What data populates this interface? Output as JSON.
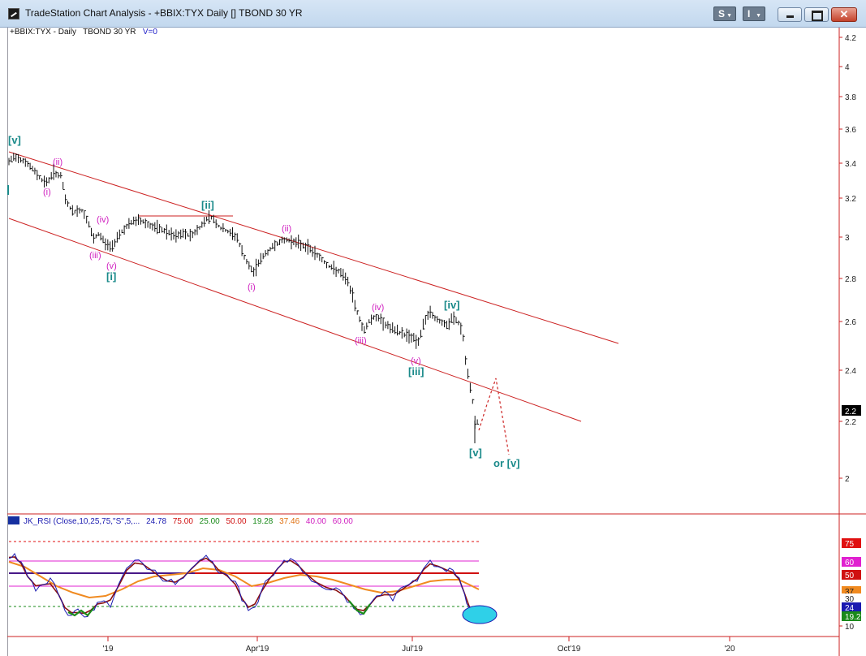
{
  "window": {
    "title": "TradeStation Chart Analysis - +BBIX:TYX Daily [] TBOND 30 YR",
    "menu_s": "S",
    "menu_i": "I",
    "close_glyph": "✕"
  },
  "series_header": {
    "symbol": "+BBIX:TYX - Daily",
    "name": "TBOND 30 YR",
    "volume": "V=0"
  },
  "price_axis": {
    "ticks": [
      "4.2",
      "4",
      "3.8",
      "3.6",
      "3.4",
      "3.2",
      "3",
      "2.8",
      "2.6",
      "2.4",
      "2.2",
      "2"
    ],
    "last_price": "2.2"
  },
  "time_axis": {
    "ticks": [
      "'19",
      "Apr'19",
      "Jul'19",
      "Oct'19",
      "'20"
    ]
  },
  "wave_labels": [
    {
      "text": "[v]",
      "color": "#1a8a8a"
    },
    {
      "text": "(ii)",
      "color": "#d020c0"
    },
    {
      "text": "(i)",
      "color": "#d020c0"
    },
    {
      "text": "(iv)",
      "color": "#d020c0"
    },
    {
      "text": "(iii)",
      "color": "#d020c0"
    },
    {
      "text": "(v)",
      "color": "#d020c0"
    },
    {
      "text": "[i]",
      "color": "#1a8a8a"
    },
    {
      "text": "[ii]",
      "color": "#1a8a8a"
    },
    {
      "text": "(ii)",
      "color": "#d020c0"
    },
    {
      "text": "(i)",
      "color": "#d020c0"
    },
    {
      "text": "(iv)",
      "color": "#d020c0"
    },
    {
      "text": "(iii)",
      "color": "#d020c0"
    },
    {
      "text": "(v)",
      "color": "#d020c0"
    },
    {
      "text": "[iii]",
      "color": "#1a8a8a"
    },
    {
      "text": "[iv]",
      "color": "#1a8a8a"
    },
    {
      "text": "[v]",
      "color": "#1a8a8a"
    },
    {
      "text": "or [v]",
      "color": "#1a8a8a"
    }
  ],
  "indicator": {
    "name": "JK_RSI (Close,10,25,75,\"S\",5,...",
    "values": [
      {
        "text": "24.78",
        "color": "#1a1ab0"
      },
      {
        "text": "75.00",
        "color": "#d01010"
      },
      {
        "text": "25.00",
        "color": "#1a8a1a"
      },
      {
        "text": "50.00",
        "color": "#d01010"
      },
      {
        "text": "19.28",
        "color": "#1a8a1a"
      },
      {
        "text": "37.46",
        "color": "#e07010"
      },
      {
        "text": "40.00",
        "color": "#d020c0"
      },
      {
        "text": "60.00",
        "color": "#d020c0"
      }
    ],
    "axis_badges": [
      {
        "text": "75",
        "color": "#e01010"
      },
      {
        "text": "60",
        "color": "#e020d0"
      },
      {
        "text": "50",
        "color": "#d01010"
      },
      {
        "text": "37",
        "color": "#f08a20"
      },
      {
        "text": "30",
        "color": "#ffffff"
      },
      {
        "text": "24",
        "color": "#1a1ab0"
      },
      {
        "text": "19.2",
        "color": "#1a8a1a"
      }
    ],
    "axis_tick_10": "10"
  },
  "colors": {
    "channel": "#cc2222",
    "bars": "#111111",
    "rsi_blue": "#1a1ab0",
    "rsi_dark_red": "#8a1010",
    "rsi_orange": "#f08a20",
    "rsi_magenta": "#e020d0",
    "highlight_cyan": "#2fd0e8"
  }
}
